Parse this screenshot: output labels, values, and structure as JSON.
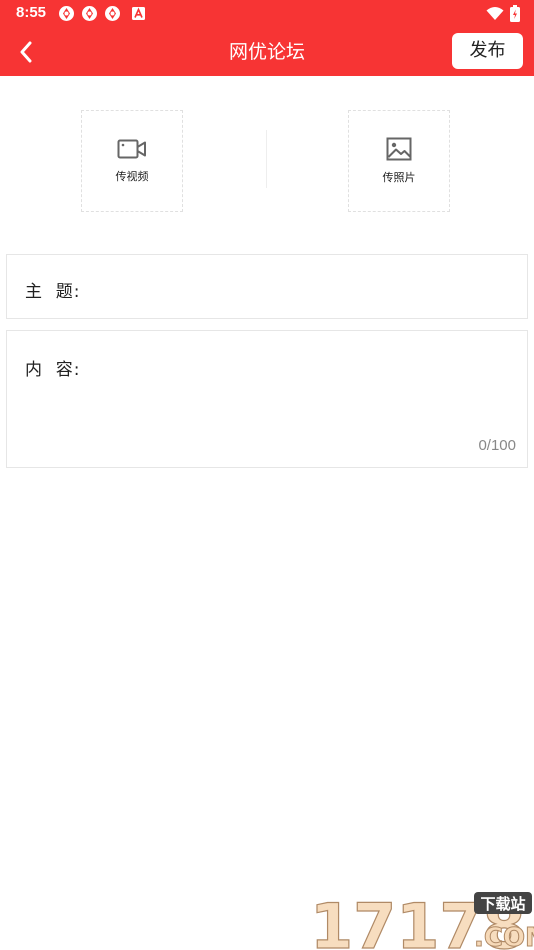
{
  "status_bar": {
    "time": "8:55",
    "left_icons": [
      "notification-app-icon",
      "notification-app-icon",
      "notification-app-icon",
      "notification-a-icon"
    ],
    "right_icons": [
      "wifi-icon",
      "battery-charging-icon"
    ]
  },
  "app_bar": {
    "back_icon": "chevron-left-icon",
    "title": "网优论坛",
    "publish_label": "发布",
    "background": "#f73434"
  },
  "uploads": {
    "video_label": "传视频",
    "video_icon": "video-camera-icon",
    "photo_label": "传照片",
    "photo_icon": "image-icon"
  },
  "form": {
    "subject_label": "主  题:",
    "subject_value": "",
    "content_label": "内  容:",
    "content_value": "",
    "char_counter": "0/100"
  },
  "watermark": {
    "number": "17178",
    "badge": "下载站",
    "domain": ".COM"
  }
}
